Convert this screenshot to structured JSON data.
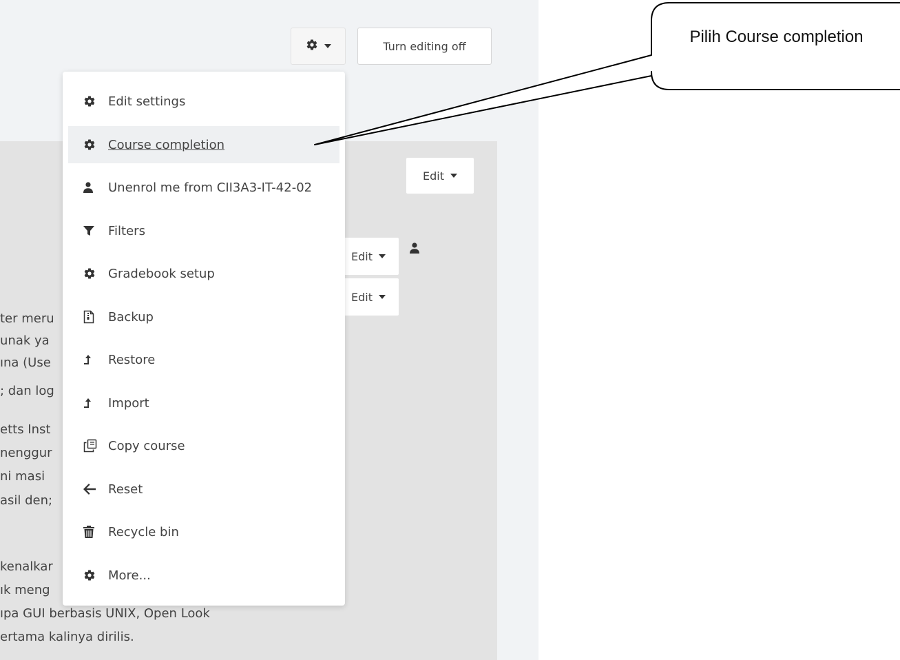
{
  "toolbar": {
    "gear_icon": "gear-icon",
    "turn_editing_label": "Turn editing off"
  },
  "edit_buttons": {
    "main_label": "Edit",
    "row1_label": "Edit",
    "row2_label": "Edit"
  },
  "background_text": [
    "ter meru",
    "unak ya",
    "ına (Use",
    "; dan log",
    "etts Inst",
    "nenggur",
    "ni  masi",
    "asil den;",
    "kenalkar",
    "ık meng",
    "ıpa GUI berbasis UNIX, Open Look",
    "ertama kalinya dirilis."
  ],
  "menu": {
    "items": [
      {
        "label": "Edit settings",
        "icon": "gear-icon"
      },
      {
        "label": "Course completion",
        "icon": "gear-icon",
        "active": true
      },
      {
        "label": "Unenrol me from CII3A3-IT-42-02",
        "icon": "user-icon"
      },
      {
        "label": "Filters",
        "icon": "filter-icon"
      },
      {
        "label": "Gradebook setup",
        "icon": "gear-icon"
      },
      {
        "label": "Backup",
        "icon": "file-archive-icon"
      },
      {
        "label": "Restore",
        "icon": "upload-arrow-icon"
      },
      {
        "label": "Import",
        "icon": "upload-arrow-icon"
      },
      {
        "label": "Copy course",
        "icon": "copy-icon"
      },
      {
        "label": "Reset",
        "icon": "arrow-left-icon"
      },
      {
        "label": "Recycle bin",
        "icon": "trash-icon"
      },
      {
        "label": "More...",
        "icon": "gear-icon"
      }
    ]
  },
  "callout": {
    "text": "Pilih Course completion"
  },
  "colors": {
    "page_bg": "#f1f3f5",
    "content_panel": "#e3e3e3",
    "menu_active_bg": "#eef0f2"
  }
}
